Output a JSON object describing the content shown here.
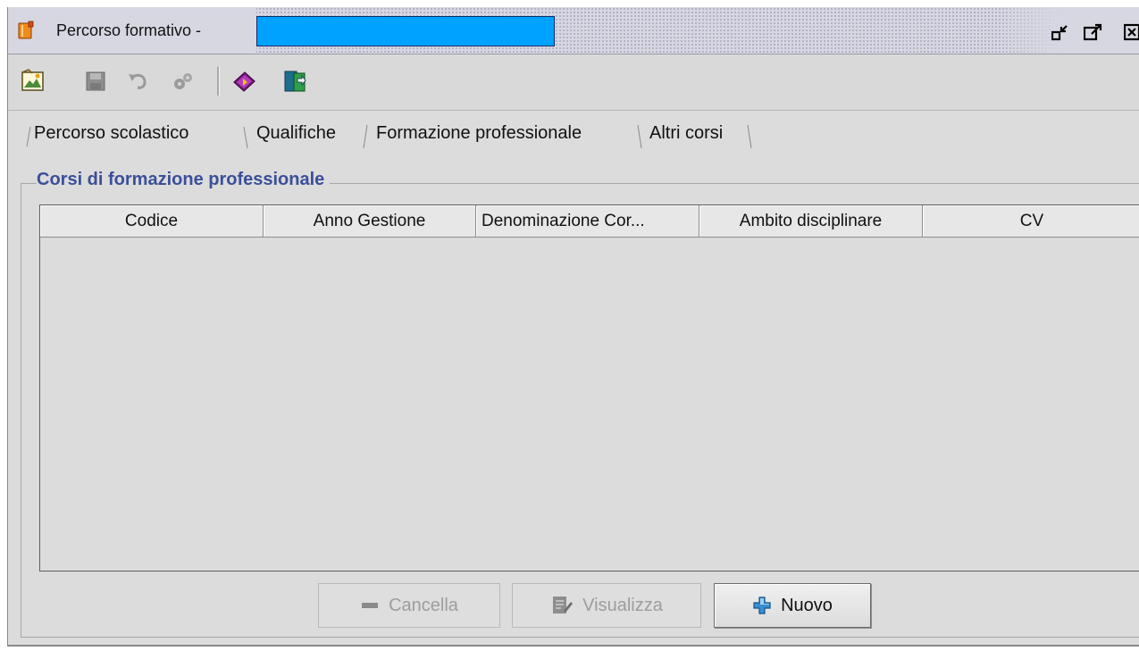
{
  "window": {
    "title": "Percorso formativo -"
  },
  "toolbar": {
    "icons": [
      "edit-picture-icon",
      "save-disk-icon",
      "undo-icon",
      "settings-gear-icon",
      "book-icon",
      "exit-door-icon"
    ]
  },
  "tabs": [
    {
      "label": "Percorso scolastico",
      "selected": false
    },
    {
      "label": "Qualifiche",
      "selected": false
    },
    {
      "label": "Formazione professionale",
      "selected": true
    },
    {
      "label": "Altri corsi",
      "selected": false
    }
  ],
  "group": {
    "title": "Corsi di formazione professionale"
  },
  "table": {
    "columns": [
      "Codice",
      "Anno Gestione",
      "Denominazione Cor...",
      "Ambito disciplinare",
      "CV"
    ],
    "rows": []
  },
  "buttons": {
    "cancella": "Cancella",
    "visualizza": "Visualizza",
    "nuovo": "Nuovo"
  },
  "colors": {
    "redaction": "#00a2ff",
    "group_title": "#3b4f9a"
  }
}
